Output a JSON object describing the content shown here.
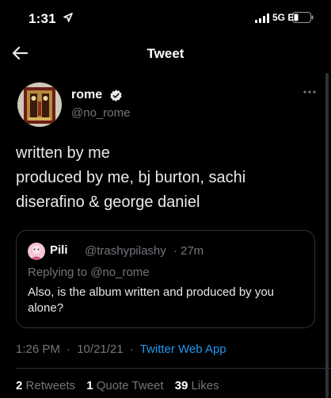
{
  "status": {
    "time": "1:31",
    "network": "5G E"
  },
  "nav": {
    "title": "Tweet"
  },
  "tweet": {
    "author_name": "rome",
    "handle": "@no_rome",
    "text_lines": [
      "written by me",
      "produced by me, bj burton, sachi",
      "diserafino & george daniel"
    ],
    "timestamp": "1:26 PM",
    "date": "10/21/21",
    "source": "Twitter Web App"
  },
  "quote": {
    "author_name": "Pili",
    "handle": "@trashypilashy",
    "separator": "·",
    "time": "27m",
    "reply_prefix": "Replying to",
    "reply_mention": "@no_rome",
    "text": "Also, is the album written and produced by you alone?"
  },
  "stats": {
    "retweets_count": "2",
    "retweets_label": "Retweets",
    "quotes_count": "1",
    "quotes_label": "Quote Tweet",
    "likes_count": "39",
    "likes_label": "Likes"
  },
  "icons": {
    "location": "location-arrow-icon",
    "signal": "signal-bars-icon",
    "battery": "battery-icon",
    "back": "back-arrow-icon",
    "verified": "verified-badge-icon",
    "more": "more-dots-icon"
  },
  "colors": {
    "background": "#000000",
    "accent": "#1d9bf0",
    "secondary_text": "#71767b",
    "border": "#2f3336"
  }
}
